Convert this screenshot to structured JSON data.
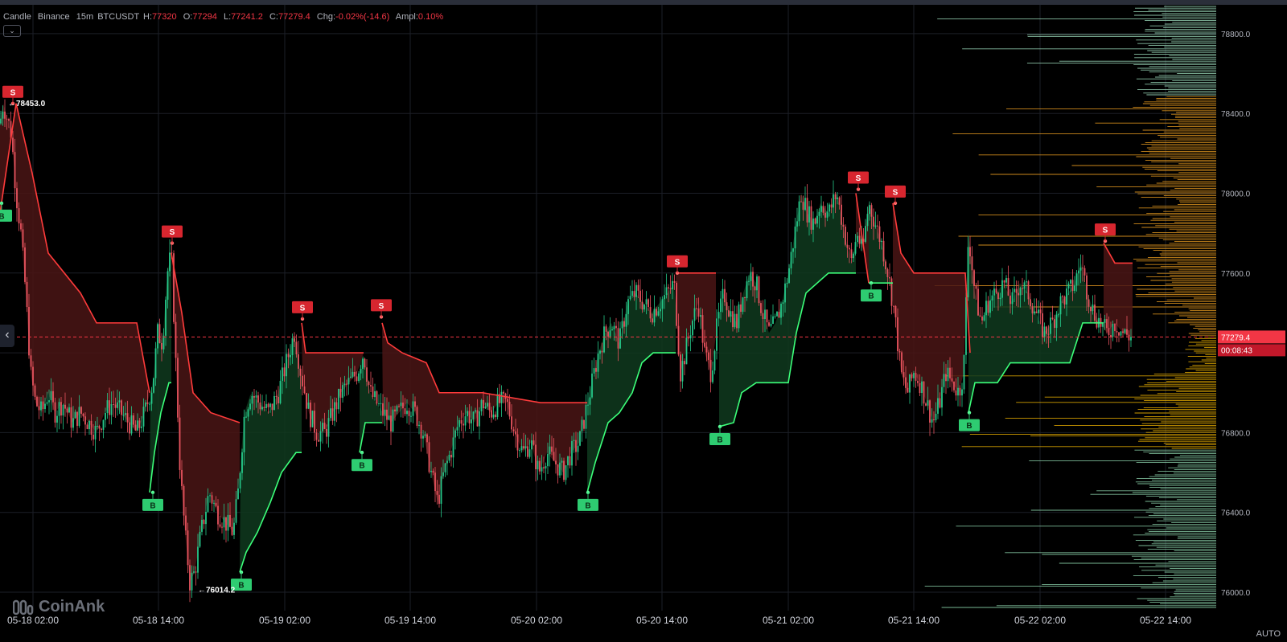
{
  "legend": {
    "type": "Candle",
    "exchange": "Binance",
    "interval": "15m",
    "symbol": "BTCUSDT",
    "h_label": "H:",
    "h": "77320",
    "o_label": "O:",
    "o": "77294",
    "l_label": "L:",
    "l": "77241.2",
    "c_label": "C:",
    "c": "77279.4",
    "chg_label": "Chg:",
    "chg": "-0.02%(-14.6)",
    "ampl_label": "Ampl:",
    "ampl": "0.10%"
  },
  "logo_text": "CoinAnk",
  "auto_label": "AUTO",
  "colors": {
    "up": "#26c98a",
    "down": "#e8545f",
    "buy": "#2ecc71",
    "sell": "#d7262f",
    "price_line": "#f23645",
    "volume_up": "#f5b800",
    "volume_down": "#7fd6c2"
  },
  "chart_data": {
    "type": "candlestick",
    "symbol": "BTCUSDT",
    "interval": "15m",
    "ylim": [
      75900,
      78950
    ],
    "y_ticks": [
      76000,
      76400,
      76800,
      77200,
      77600,
      78000,
      78400,
      78800
    ],
    "y_tick_labels": [
      "76000.0",
      "76400.0",
      "76800.0",
      "77200.0",
      "77600.0",
      "78000.0",
      "78400.0",
      "78800.0"
    ],
    "x_tick_labels": [
      "05-18 02:00",
      "05-18 14:00",
      "05-19 02:00",
      "05-19 14:00",
      "05-20 02:00",
      "05-20 14:00",
      "05-21 02:00",
      "05-21 14:00",
      "05-22 02:00",
      "05-22 14:00"
    ],
    "current_price": "77279.4",
    "countdown": "00:08:43",
    "price_path": [
      [
        0,
        78350
      ],
      [
        4,
        78450
      ],
      [
        14,
        78300
      ],
      [
        20,
        78000
      ],
      [
        26,
        77800
      ],
      [
        32,
        77500
      ],
      [
        38,
        77100
      ],
      [
        44,
        76950
      ],
      [
        52,
        76900
      ],
      [
        60,
        77000
      ],
      [
        68,
        76900
      ],
      [
        78,
        76950
      ],
      [
        90,
        76850
      ],
      [
        100,
        76900
      ],
      [
        110,
        76850
      ],
      [
        120,
        76800
      ],
      [
        130,
        76900
      ],
      [
        140,
        76950
      ],
      [
        150,
        76900
      ],
      [
        160,
        76850
      ],
      [
        170,
        76800
      ],
      [
        180,
        76900
      ],
      [
        190,
        77050
      ],
      [
        196,
        77300
      ],
      [
        202,
        77250
      ],
      [
        208,
        77600
      ],
      [
        213,
        77700
      ],
      [
        218,
        77200
      ],
      [
        224,
        76600
      ],
      [
        230,
        76300
      ],
      [
        236,
        76050
      ],
      [
        242,
        76100
      ],
      [
        250,
        76300
      ],
      [
        260,
        76500
      ],
      [
        270,
        76400
      ],
      [
        280,
        76350
      ],
      [
        290,
        76300
      ],
      [
        296,
        76500
      ],
      [
        304,
        76900
      ],
      [
        312,
        77000
      ],
      [
        322,
        76950
      ],
      [
        334,
        76900
      ],
      [
        346,
        77000
      ],
      [
        356,
        77150
      ],
      [
        366,
        77300
      ],
      [
        374,
        77100
      ],
      [
        384,
        76900
      ],
      [
        394,
        76800
      ],
      [
        404,
        76800
      ],
      [
        414,
        76900
      ],
      [
        424,
        77000
      ],
      [
        434,
        77050
      ],
      [
        444,
        77100
      ],
      [
        452,
        77200
      ],
      [
        460,
        77000
      ],
      [
        468,
        76950
      ],
      [
        476,
        76900
      ],
      [
        486,
        76850
      ],
      [
        496,
        76900
      ],
      [
        506,
        76950
      ],
      [
        516,
        76900
      ],
      [
        526,
        76800
      ],
      [
        536,
        76600
      ],
      [
        544,
        76450
      ],
      [
        552,
        76600
      ],
      [
        560,
        76700
      ],
      [
        570,
        76850
      ],
      [
        580,
        76900
      ],
      [
        590,
        76850
      ],
      [
        600,
        76950
      ],
      [
        610,
        76900
      ],
      [
        620,
        76950
      ],
      [
        630,
        76950
      ],
      [
        640,
        76800
      ],
      [
        650,
        76700
      ],
      [
        660,
        76750
      ],
      [
        670,
        76600
      ],
      [
        680,
        76700
      ],
      [
        690,
        76650
      ],
      [
        700,
        76600
      ],
      [
        710,
        76700
      ],
      [
        720,
        76750
      ],
      [
        728,
        76900
      ],
      [
        736,
        77050
      ],
      [
        744,
        77200
      ],
      [
        752,
        77300
      ],
      [
        760,
        77350
      ],
      [
        770,
        77250
      ],
      [
        780,
        77450
      ],
      [
        790,
        77500
      ],
      [
        800,
        77450
      ],
      [
        810,
        77400
      ],
      [
        820,
        77450
      ],
      [
        830,
        77500
      ],
      [
        838,
        77550
      ],
      [
        846,
        77100
      ],
      [
        852,
        77200
      ],
      [
        860,
        77350
      ],
      [
        868,
        77450
      ],
      [
        876,
        77200
      ],
      [
        884,
        77100
      ],
      [
        892,
        77350
      ],
      [
        900,
        77500
      ],
      [
        908,
        77400
      ],
      [
        916,
        77350
      ],
      [
        924,
        77500
      ],
      [
        932,
        77600
      ],
      [
        940,
        77550
      ],
      [
        948,
        77400
      ],
      [
        956,
        77300
      ],
      [
        964,
        77350
      ],
      [
        972,
        77450
      ],
      [
        980,
        77600
      ],
      [
        988,
        77800
      ],
      [
        996,
        78000
      ],
      [
        1004,
        77900
      ],
      [
        1012,
        77850
      ],
      [
        1020,
        77950
      ],
      [
        1030,
        77900
      ],
      [
        1040,
        78000
      ],
      [
        1050,
        77800
      ],
      [
        1058,
        77650
      ],
      [
        1066,
        77800
      ],
      [
        1072,
        77700
      ],
      [
        1080,
        77950
      ],
      [
        1088,
        77850
      ],
      [
        1096,
        77750
      ],
      [
        1104,
        77600
      ],
      [
        1112,
        77400
      ],
      [
        1120,
        77100
      ],
      [
        1128,
        77000
      ],
      [
        1136,
        77100
      ],
      [
        1144,
        77050
      ],
      [
        1152,
        76950
      ],
      [
        1160,
        76850
      ],
      [
        1168,
        76950
      ],
      [
        1176,
        77100
      ],
      [
        1184,
        77050
      ],
      [
        1192,
        77000
      ],
      [
        1198,
        77100
      ],
      [
        1204,
        77800
      ],
      [
        1212,
        77500
      ],
      [
        1220,
        77350
      ],
      [
        1228,
        77450
      ],
      [
        1238,
        77500
      ],
      [
        1248,
        77550
      ],
      [
        1258,
        77450
      ],
      [
        1268,
        77550
      ],
      [
        1278,
        77500
      ],
      [
        1288,
        77400
      ],
      [
        1298,
        77300
      ],
      [
        1308,
        77350
      ],
      [
        1318,
        77450
      ],
      [
        1328,
        77500
      ],
      [
        1336,
        77550
      ],
      [
        1344,
        77650
      ],
      [
        1352,
        77500
      ],
      [
        1360,
        77400
      ],
      [
        1368,
        77350
      ],
      [
        1376,
        77300
      ],
      [
        1386,
        77350
      ],
      [
        1396,
        77300
      ],
      [
        1406,
        77280
      ]
    ],
    "stop_line": [
      {
        "side": "sell",
        "points": [
          [
            0,
            77900
          ],
          [
            20,
            78450
          ],
          [
            40,
            78100
          ],
          [
            60,
            77700
          ],
          [
            100,
            77500
          ],
          [
            120,
            77350
          ],
          [
            170,
            77350
          ],
          [
            186,
            77000
          ]
        ]
      },
      {
        "side": "buy",
        "points": [
          [
            186,
            76500
          ],
          [
            192,
            76700
          ],
          [
            200,
            76900
          ],
          [
            210,
            77050
          ],
          [
            213,
            77050
          ]
        ]
      },
      {
        "side": "sell",
        "points": [
          [
            213,
            77700
          ],
          [
            226,
            77400
          ],
          [
            240,
            77000
          ],
          [
            262,
            76900
          ],
          [
            298,
            76850
          ]
        ]
      },
      {
        "side": "buy",
        "points": [
          [
            298,
            76100
          ],
          [
            306,
            76200
          ],
          [
            320,
            76300
          ],
          [
            336,
            76450
          ],
          [
            350,
            76600
          ],
          [
            368,
            76700
          ],
          [
            375,
            76700
          ]
        ]
      },
      {
        "side": "sell",
        "points": [
          [
            375,
            77350
          ],
          [
            380,
            77200
          ],
          [
            447,
            77200
          ],
          [
            452,
            77200
          ]
        ]
      },
      {
        "side": "buy",
        "points": [
          [
            447,
            76700
          ],
          [
            454,
            76850
          ],
          [
            470,
            76850
          ],
          [
            475,
            76850
          ]
        ]
      },
      {
        "side": "sell",
        "points": [
          [
            475,
            77350
          ],
          [
            482,
            77250
          ],
          [
            500,
            77200
          ],
          [
            530,
            77150
          ],
          [
            546,
            77000
          ],
          [
            600,
            77000
          ],
          [
            672,
            76950
          ],
          [
            730,
            76950
          ]
        ]
      },
      {
        "side": "buy",
        "points": [
          [
            730,
            76500
          ],
          [
            740,
            76650
          ],
          [
            756,
            76850
          ],
          [
            770,
            76900
          ],
          [
            786,
            77000
          ],
          [
            798,
            77150
          ],
          [
            812,
            77200
          ],
          [
            840,
            77200
          ]
        ]
      },
      {
        "side": "sell",
        "points": [
          [
            840,
            77600
          ],
          [
            890,
            77600
          ]
        ]
      },
      {
        "side": "buy",
        "points": [
          [
            894,
            76830
          ],
          [
            912,
            76850
          ],
          [
            922,
            77000
          ],
          [
            940,
            77050
          ],
          [
            980,
            77050
          ],
          [
            990,
            77300
          ],
          [
            1002,
            77500
          ],
          [
            1030,
            77600
          ],
          [
            1064,
            77600
          ]
        ]
      },
      {
        "side": "sell",
        "points": [
          [
            1064,
            78000
          ],
          [
            1080,
            77550
          ]
        ]
      },
      {
        "side": "buy",
        "points": [
          [
            1080,
            77550
          ],
          [
            1110,
            77550
          ]
        ]
      },
      {
        "side": "sell",
        "points": [
          [
            1110,
            77950
          ],
          [
            1120,
            77700
          ],
          [
            1136,
            77600
          ],
          [
            1160,
            77600
          ],
          [
            1200,
            77600
          ],
          [
            1206,
            77200
          ]
        ]
      },
      {
        "side": "buy",
        "points": [
          [
            1204,
            76900
          ],
          [
            1212,
            77050
          ],
          [
            1240,
            77050
          ],
          [
            1256,
            77150
          ],
          [
            1330,
            77150
          ],
          [
            1346,
            77350
          ],
          [
            1372,
            77350
          ]
        ]
      },
      {
        "side": "sell",
        "points": [
          [
            1372,
            77750
          ],
          [
            1386,
            77650
          ],
          [
            1408,
            77650
          ]
        ]
      }
    ],
    "signals": [
      {
        "type": "S",
        "label": "S",
        "x": 16,
        "price": 78450
      },
      {
        "type": "B",
        "label": "B",
        "x": 2,
        "price": 77950
      },
      {
        "type": "S",
        "label": "S",
        "x": 214,
        "price": 77750
      },
      {
        "type": "B",
        "label": "B",
        "x": 190,
        "price": 76500
      },
      {
        "type": "B",
        "label": "B",
        "x": 300,
        "price": 76100
      },
      {
        "type": "S",
        "label": "S",
        "x": 376,
        "price": 77370
      },
      {
        "type": "B",
        "label": "B",
        "x": 450,
        "price": 76700
      },
      {
        "type": "S",
        "label": "S",
        "x": 474,
        "price": 77380
      },
      {
        "type": "B",
        "label": "B",
        "x": 731,
        "price": 76500
      },
      {
        "type": "S",
        "label": "S",
        "x": 842,
        "price": 77600
      },
      {
        "type": "B",
        "label": "B",
        "x": 895,
        "price": 76830
      },
      {
        "type": "S",
        "label": "S",
        "x": 1067,
        "price": 78020
      },
      {
        "type": "B",
        "label": "B",
        "x": 1083,
        "price": 77550
      },
      {
        "type": "S",
        "label": "S",
        "x": 1113,
        "price": 77950
      },
      {
        "type": "B",
        "label": "B",
        "x": 1205,
        "price": 76900
      },
      {
        "type": "S",
        "label": "S",
        "x": 1374,
        "price": 77760
      }
    ],
    "annotations": [
      {
        "text": "78453.0",
        "x": 10,
        "price": 78453
      },
      {
        "text": "76014.2",
        "x": 246,
        "price": 76014
      }
    ]
  }
}
